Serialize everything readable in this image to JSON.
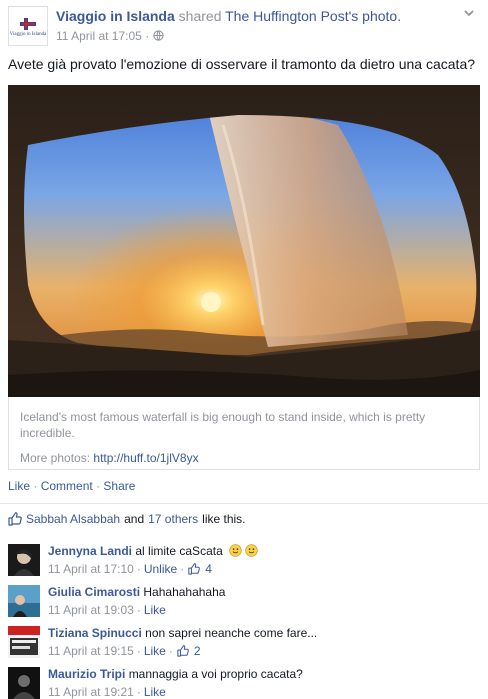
{
  "post": {
    "page_name": "Viaggio in Islanda",
    "page_logo_text": "Viaggio in Islanda",
    "shared_word": "shared",
    "shared_from": "The Huffington Post",
    "shared_suffix": "'s photo.",
    "timestamp": "11 April at 17:05",
    "separator": "·",
    "privacy_icon": "globe-icon",
    "text": "Avete già provato l'emozione di osservare il tramonto da dietro una cacata?",
    "attachment_caption": "Iceland's most famous waterfall is big enough to stand inside, which is pretty incredible.",
    "more_photos_label": "More photos:",
    "more_photos_link": "http://huff.to/1jlV8yx"
  },
  "actions": {
    "like": "Like",
    "comment": "Comment",
    "share": "Share",
    "sep": "·"
  },
  "likes": {
    "first_person": "Sabbah Alsabbah",
    "and": "and",
    "others": "17 others",
    "suffix": "like this."
  },
  "comments": [
    {
      "author": "Jennyna Landi",
      "text": "al limite caScata",
      "emojis": [
        "smile-emoji",
        "smile-emoji"
      ],
      "time": "11 April at 17:10",
      "action": "Unlike",
      "like_count": "4"
    },
    {
      "author": "Giulia Cimarosti",
      "text": "Hahahahahaha",
      "time": "11 April at 19:03",
      "action": "Like"
    },
    {
      "author": "Tiziana Spinucci",
      "text": "non saprei neanche come fare...",
      "time": "11 April at 19:15",
      "action": "Like",
      "like_count": "2"
    },
    {
      "author": "Maurizio Tripi",
      "text": "mannaggia a voi proprio cacata?",
      "time": "11 April at 19:21",
      "action": "Like"
    }
  ],
  "colors": {
    "link": "#3b5998",
    "meta": "#90949c",
    "text": "#141823"
  }
}
